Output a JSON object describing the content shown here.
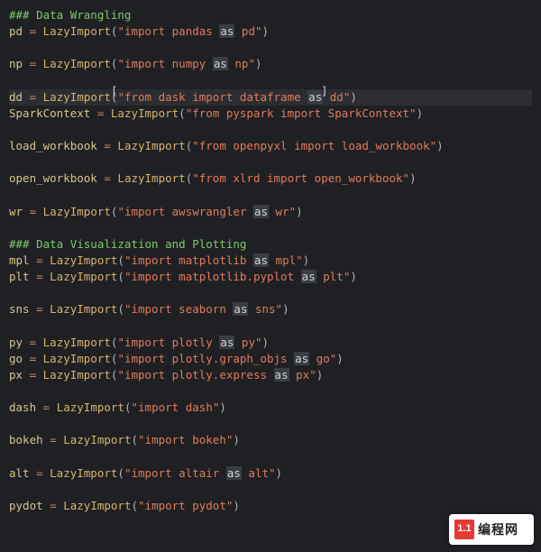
{
  "sections": [
    {
      "type": "comment",
      "text": "### Data Wrangling"
    },
    {
      "type": "assign",
      "var": "pd",
      "fn": "LazyImport",
      "pre": "import pandas ",
      "kw": "as",
      "post": " pd",
      "hl": false
    },
    {
      "type": "blank"
    },
    {
      "type": "assign",
      "var": "np",
      "fn": "LazyImport",
      "pre": "import numpy ",
      "kw": "as",
      "post": " np",
      "hl": false
    },
    {
      "type": "blank"
    },
    {
      "type": "assign",
      "var": "dd",
      "fn": "LazyImport",
      "pre": "from dask import dataframe ",
      "kw": "as",
      "post": " dd",
      "hl": true
    },
    {
      "type": "assign",
      "var": "SparkContext",
      "fn": "LazyImport",
      "pre": "from pyspark import SparkContext",
      "kw": "",
      "post": "",
      "hl": false
    },
    {
      "type": "blank"
    },
    {
      "type": "assign",
      "var": "load_workbook",
      "fn": "LazyImport",
      "pre": "from openpyxl import load_workbook",
      "kw": "",
      "post": "",
      "hl": false
    },
    {
      "type": "blank"
    },
    {
      "type": "assign",
      "var": "open_workbook",
      "fn": "LazyImport",
      "pre": "from xlrd import open_workbook",
      "kw": "",
      "post": "",
      "hl": false
    },
    {
      "type": "blank"
    },
    {
      "type": "assign",
      "var": "wr",
      "fn": "LazyImport",
      "pre": "import awswrangler ",
      "kw": "as",
      "post": " wr",
      "hl": false
    },
    {
      "type": "blank"
    },
    {
      "type": "comment",
      "text": "### Data Visualization and Plotting"
    },
    {
      "type": "assign",
      "var": "mpl",
      "fn": "LazyImport",
      "pre": "import matplotlib ",
      "kw": "as",
      "post": " mpl",
      "hl": false
    },
    {
      "type": "assign",
      "var": "plt",
      "fn": "LazyImport",
      "pre": "import matplotlib.pyplot ",
      "kw": "as",
      "post": " plt",
      "hl": false
    },
    {
      "type": "blank"
    },
    {
      "type": "assign",
      "var": "sns",
      "fn": "LazyImport",
      "pre": "import seaborn ",
      "kw": "as",
      "post": " sns",
      "hl": false
    },
    {
      "type": "blank"
    },
    {
      "type": "assign",
      "var": "py",
      "fn": "LazyImport",
      "pre": "import plotly ",
      "kw": "as",
      "post": " py",
      "hl": false
    },
    {
      "type": "assign",
      "var": "go",
      "fn": "LazyImport",
      "pre": "import plotly.graph_objs ",
      "kw": "as",
      "post": " go",
      "hl": false
    },
    {
      "type": "assign",
      "var": "px",
      "fn": "LazyImport",
      "pre": "import plotly.express ",
      "kw": "as",
      "post": " px",
      "hl": false
    },
    {
      "type": "blank"
    },
    {
      "type": "assign",
      "var": "dash",
      "fn": "LazyImport",
      "pre": "import dash",
      "kw": "",
      "post": "",
      "hl": false
    },
    {
      "type": "blank"
    },
    {
      "type": "assign",
      "var": "bokeh",
      "fn": "LazyImport",
      "pre": "import bokeh",
      "kw": "",
      "post": "",
      "hl": false
    },
    {
      "type": "blank"
    },
    {
      "type": "assign",
      "var": "alt",
      "fn": "LazyImport",
      "pre": "import altair ",
      "kw": "as",
      "post": " alt",
      "hl": false
    },
    {
      "type": "blank"
    },
    {
      "type": "assign",
      "var": "pydot",
      "fn": "LazyImport",
      "pre": "import pydot",
      "kw": "",
      "post": "",
      "hl": false
    }
  ],
  "badge": {
    "logo": "1.1",
    "text": "编程网"
  }
}
